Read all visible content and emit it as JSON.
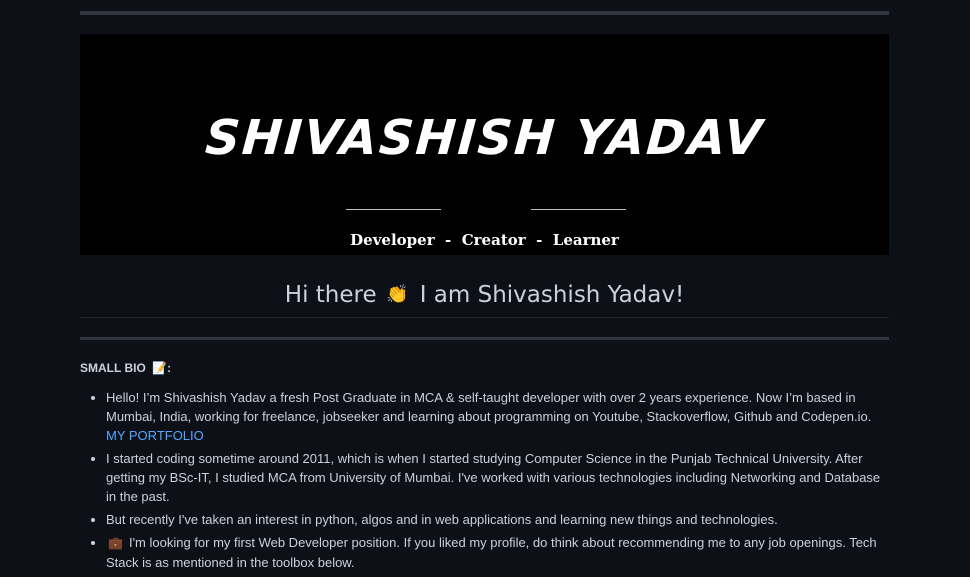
{
  "banner": {
    "name": "SHIVASHISH YADAV",
    "tagline": "Developer  -  Creator  -  Learner"
  },
  "heading": {
    "before": "Hi there",
    "emoji": "👏",
    "after": "I am Shivashish Yadav!"
  },
  "bio": {
    "title": "SMALL BIO",
    "title_emoji": "📝",
    "title_suffix": ":",
    "items": [
      {
        "text": "Hello! I’m Shivashish Yadav a fresh Post Graduate in MCA & self-taught developer with over 2 years experience. Now I’m based in Mumbai, India, working for freelance, jobseeker and learning about programming on Youtube, Stackoverflow, Github and Codepen.io.",
        "link": "MY PORTFOLIO"
      },
      {
        "text": "I started coding sometime around 2011, which is when I started studying Computer Science in the Punjab Technical University. After getting my BSc-IT, I studied MCA from University of Mumbai. I've worked with various technologies including Networking and Database in the past."
      },
      {
        "text": "But recently I've taken an interest in python, algos and in web applications and learning new things and technologies."
      },
      {
        "emoji": "💼",
        "text": "I'm looking for my first Web Developer position. If you liked my profile, do think about recommending me to any job openings. Tech Stack is as mentioned in the toolbox below."
      }
    ]
  },
  "colors": {
    "background": "#0d1117",
    "text": "#c9d1d9",
    "link": "#58a6ff",
    "banner_bg": "#000000"
  }
}
